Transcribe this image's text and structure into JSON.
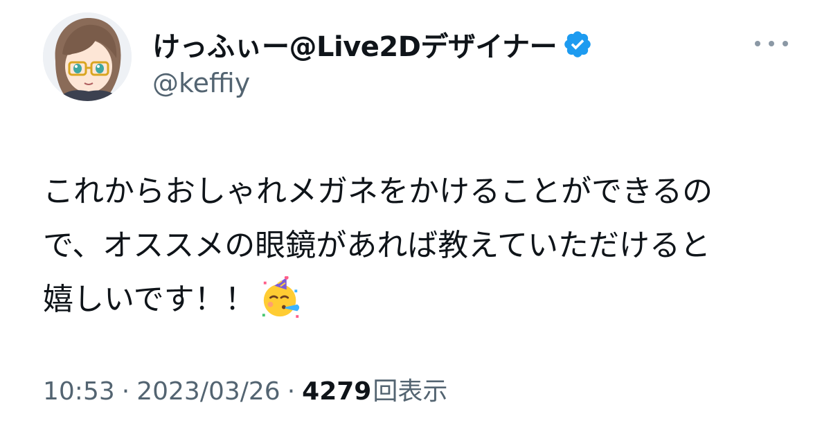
{
  "author": {
    "display_name": "けっふぃー@Live2Dデザイナー",
    "handle": "@keffiy",
    "verified_icon": "verified-badge-icon",
    "avatar_icon": "avatar-illustration"
  },
  "tweet": {
    "lines": [
      "これからおしゃれメガネをかけることができるの",
      "で、オススメの眼鏡があれば教えていただけると",
      "嬉しいです！！"
    ],
    "emoji": "partying-face-emoji"
  },
  "meta": {
    "time": "10:53",
    "separator": "·",
    "date": "2023/03/26",
    "views_count": "4279",
    "views_label": "回表示"
  },
  "colors": {
    "primary_text": "#0f1419",
    "secondary_text": "#536471",
    "verified_blue": "#1d9bf0"
  }
}
